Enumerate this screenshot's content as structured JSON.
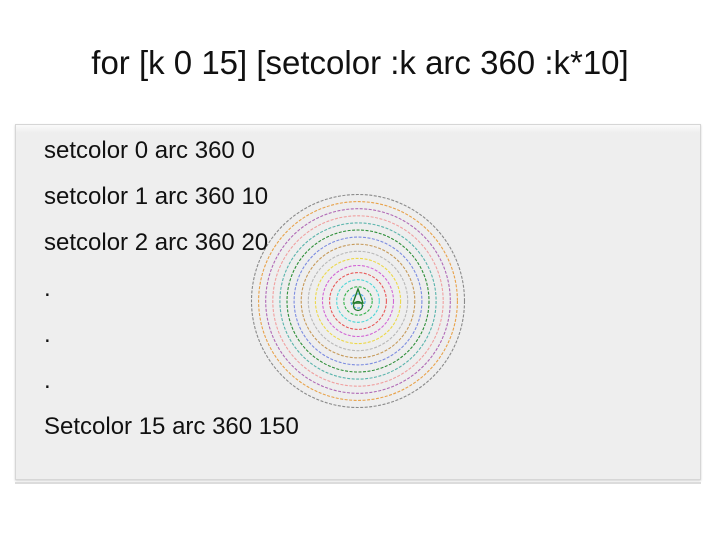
{
  "slide": {
    "title": "for [k 0 15] [setcolor :k arc 360 :k*10]"
  },
  "code_lines": [
    "setcolor 0 arc 360 0",
    "setcolor 1 arc 360 10",
    "setcolor 2 arc 360 20",
    ".",
    ".",
    ".",
    "Setcolor 15 arc 360 150"
  ],
  "drawing": {
    "turtle_icon": "triangle-turtle-icon",
    "arcs": [
      {
        "k": 0,
        "radius": 0,
        "color": "#000000"
      },
      {
        "k": 1,
        "radius": 10,
        "color": "#4fa8e8"
      },
      {
        "k": 2,
        "radius": 20,
        "color": "#34b24c"
      },
      {
        "k": 3,
        "radius": 30,
        "color": "#4fd6d6"
      },
      {
        "k": 4,
        "radius": 40,
        "color": "#e85a5a"
      },
      {
        "k": 5,
        "radius": 50,
        "color": "#d266d6"
      },
      {
        "k": 6,
        "radius": 60,
        "color": "#ecd84a"
      },
      {
        "k": 7,
        "radius": 70,
        "color": "#b8b8b8"
      },
      {
        "k": 8,
        "radius": 80,
        "color": "#c69a5a"
      },
      {
        "k": 9,
        "radius": 90,
        "color": "#7c8ce0"
      },
      {
        "k": 10,
        "radius": 100,
        "color": "#2f8f3a"
      },
      {
        "k": 11,
        "radius": 110,
        "color": "#5ab4ac"
      },
      {
        "k": 12,
        "radius": 120,
        "color": "#f0a0a0"
      },
      {
        "k": 13,
        "radius": 130,
        "color": "#b06ab6"
      },
      {
        "k": 14,
        "radius": 140,
        "color": "#e8a24a"
      },
      {
        "k": 15,
        "radius": 150,
        "color": "#8a8a8a"
      }
    ]
  }
}
